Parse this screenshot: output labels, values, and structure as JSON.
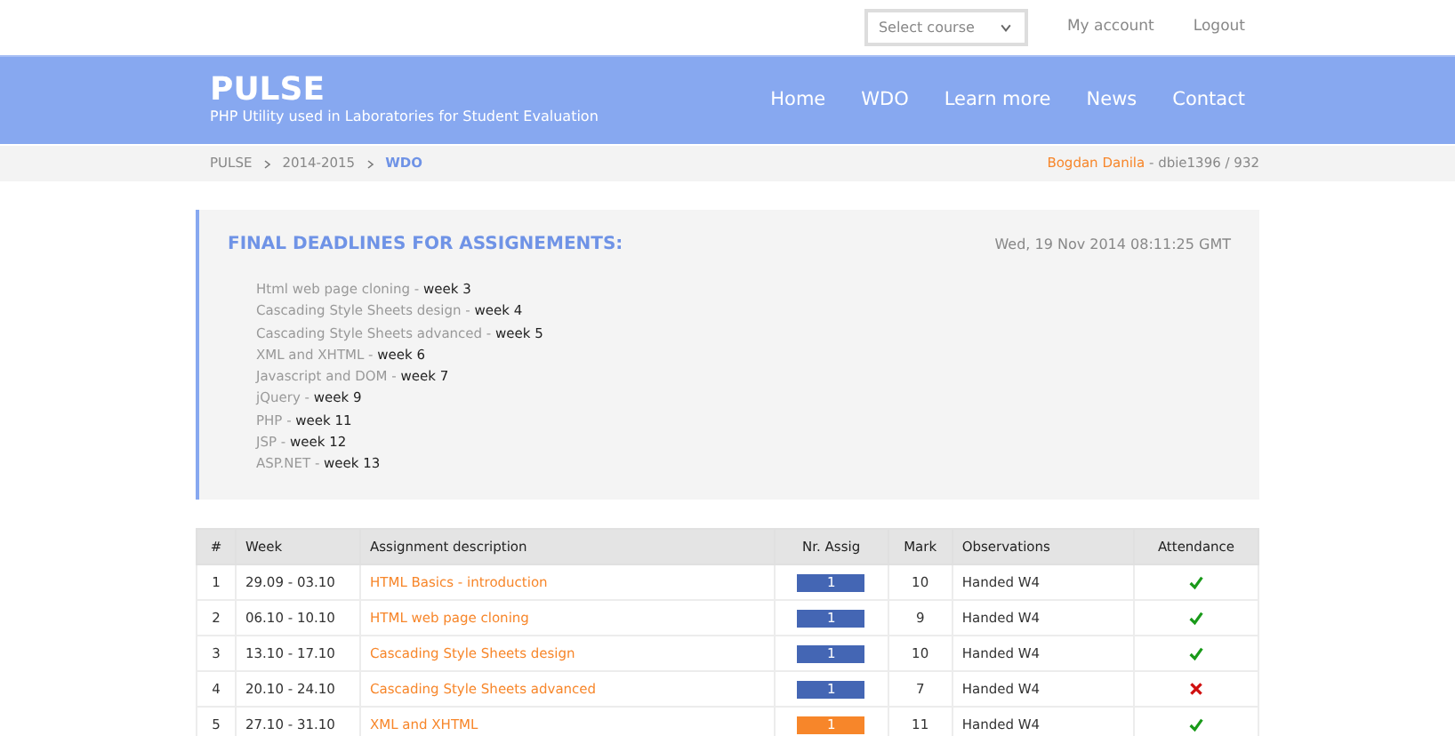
{
  "top_bar": {
    "course_select": {
      "placeholder": "Select course"
    },
    "links": [
      "My account",
      "Logout"
    ]
  },
  "header": {
    "logo": "PULSE",
    "tagline": "PHP Utility used in Laboratories for Student Evaluation",
    "nav": [
      "Home",
      "WDO",
      "Learn more",
      "News",
      "Contact"
    ]
  },
  "breadcrumb": {
    "items": [
      "PULSE",
      "2014-2015",
      "WDO"
    ],
    "user_name": "Bogdan Danila",
    "user_info": " - dbie1396 / 932"
  },
  "deadlines": {
    "title": "FINAL DEADLINES FOR ASSIGNEMENTS:",
    "date": "Wed, 19 Nov 2014 08:11:25 GMT",
    "items": [
      "Html web page cloning - **week 3**",
      "Cascading Style Sheets design - **week 4**",
      "Cascading Style Sheets advanced - **week 5**",
      "XML and XHTML - **week 6**",
      "Javascript and DOM - **week 7**",
      "jQuery - **week 9**",
      "PHP - **week 11**",
      "JSP - **week 12**",
      "ASP.NET - **week 13**"
    ]
  },
  "table": {
    "columns": [
      "#",
      "Week",
      "Assignment description",
      "Nr. Assig",
      "Mark",
      "Observations",
      "Attendance"
    ],
    "rows": [
      {
        "num": "1",
        "week": "29.09 - 03.10",
        "description": "HTML Basics - introduction",
        "nr": "1",
        "color": "#4466b4",
        "mark": "10",
        "observations": "Handed W4",
        "present": true
      },
      {
        "num": "2",
        "week": "06.10 - 10.10",
        "description": "HTML web page cloning",
        "nr": "1",
        "color": "#4466b4",
        "mark": "9",
        "observations": "Handed W4",
        "present": true
      },
      {
        "num": "3",
        "week": "13.10 - 17.10",
        "description": "Cascading Style Sheets design",
        "nr": "1",
        "color": "#4466b4",
        "mark": "10",
        "observations": "Handed W4",
        "present": true
      },
      {
        "num": "4",
        "week": "20.10 - 24.10",
        "description": "Cascading Style Sheets advanced",
        "nr": "1",
        "color": "#4466b4",
        "mark": "7",
        "observations": "Handed W4",
        "present": false
      },
      {
        "num": "5",
        "week": "27.10 - 31.10",
        "description": "XML and XHTML",
        "nr": "1",
        "color": "#f7862a",
        "mark": "11",
        "observations": "Handed W4",
        "present": true
      }
    ]
  }
}
